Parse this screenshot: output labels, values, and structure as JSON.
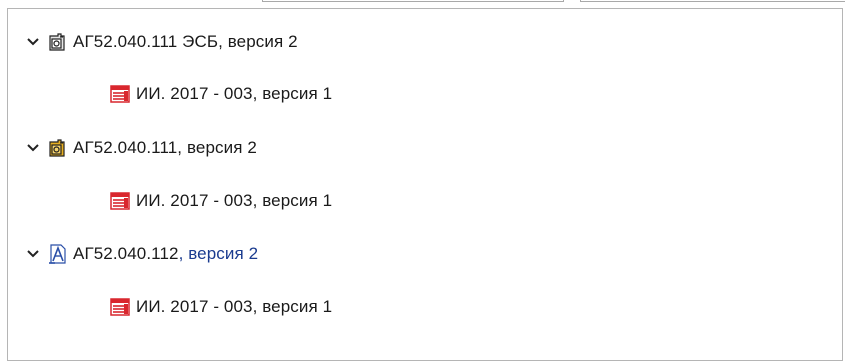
{
  "tree": {
    "nodes": [
      {
        "label": "АГ52.040.111 ЭСБ, версия 2",
        "icon": "cad-document-dark-icon",
        "expanded": true,
        "children": [
          {
            "label": "ИИ. 2017 - 003, версия 1",
            "icon": "red-document-icon"
          }
        ]
      },
      {
        "label": "АГ52.040.111, версия 2",
        "icon": "cad-document-yellow-icon",
        "expanded": true,
        "children": [
          {
            "label": "ИИ. 2017 - 003, версия 1",
            "icon": "red-document-icon"
          }
        ]
      },
      {
        "label_main": "АГ52.040.112",
        "label_suffix": ", версия 2",
        "icon": "drawing-document-icon",
        "expanded": true,
        "children": [
          {
            "label": "ИИ. 2017 - 003, версия 1",
            "icon": "red-document-icon"
          }
        ]
      }
    ]
  },
  "colors": {
    "red_doc": "#d9272e",
    "yellow_doc": "#e8b021",
    "blue_doc": "#2a4fa8"
  }
}
